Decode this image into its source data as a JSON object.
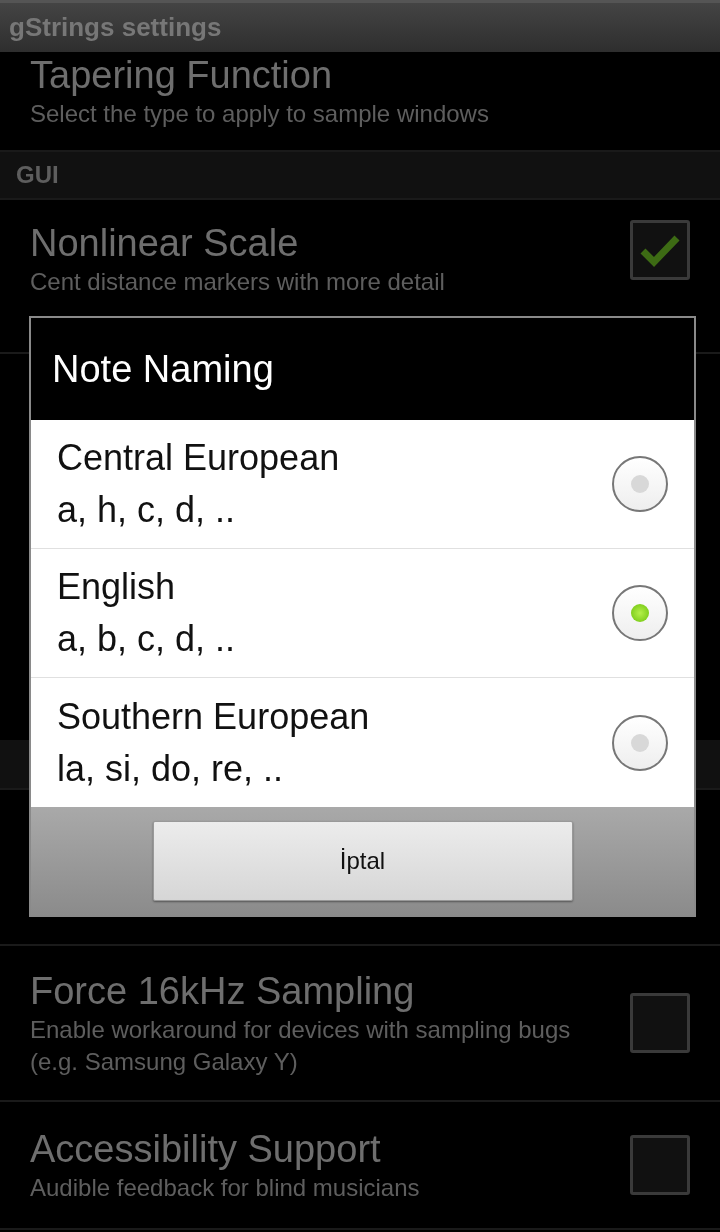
{
  "app_bar": {
    "title": "gStrings settings"
  },
  "settings_top": [
    {
      "kind": "preference",
      "title": "Tapering Function",
      "summary": "Select the type to apply to sample windows"
    },
    {
      "kind": "header",
      "title": "GUI"
    },
    {
      "kind": "checkbox",
      "title": "Nonlinear Scale",
      "summary": "Cent distance markers with more detail",
      "checked": true
    }
  ],
  "settings_bottom": [
    {
      "kind": "checkbox",
      "title": "Force 16kHz Sampling",
      "summary": "Enable workaround for devices with sampling bugs (e.g. Samsung Galaxy Y)",
      "checked": false
    },
    {
      "kind": "checkbox",
      "title": "Accessibility Support",
      "summary": "Audible feedback for blind musicians",
      "checked": false
    }
  ],
  "dialog": {
    "title": "Note Naming",
    "options": [
      {
        "label": "Central European",
        "example": "a, h, c, d, ..",
        "selected": false
      },
      {
        "label": "English",
        "example": "a, b, c, d, ..",
        "selected": true
      },
      {
        "label": "Southern European",
        "example": "la, si, do, re, ..",
        "selected": false
      }
    ],
    "button": "İptal"
  }
}
